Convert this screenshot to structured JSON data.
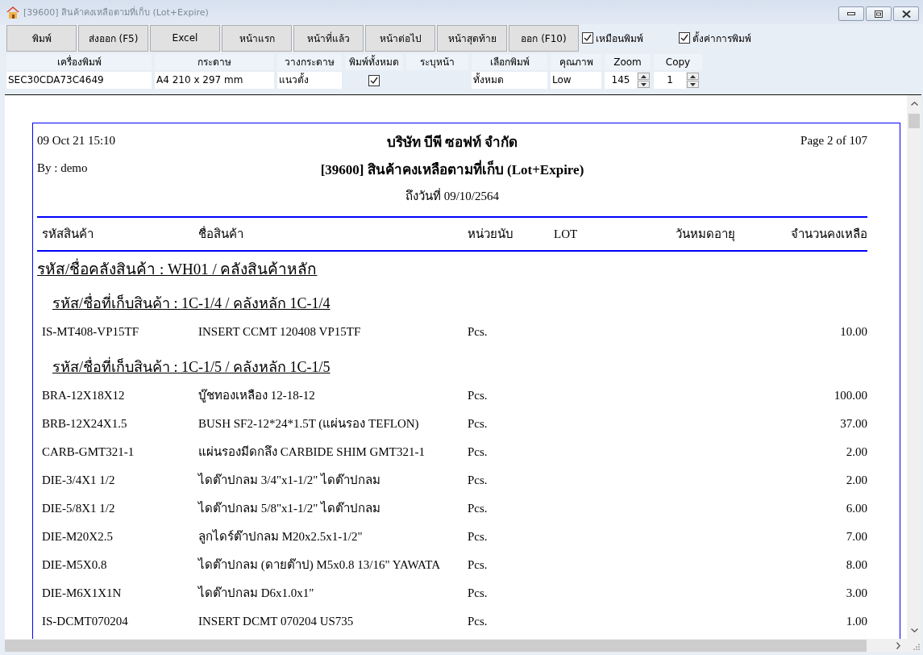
{
  "window": {
    "title": "[39600] สินค้าคงเหลือตามที่เก็บ (Lot+Expire)"
  },
  "toolbar": {
    "buttons": [
      "พิมพ์",
      "ส่งออก (F5)",
      "Excel",
      "หน้าแรก",
      "หน้าที่แล้ว",
      "หน้าต่อไป",
      "หน้าสุดท้าย",
      "ออก (F10)"
    ],
    "checkboxes": [
      {
        "label": "เหมือนพิมพ์",
        "checked": true
      },
      {
        "label": "ตั้งค่าการพิมพ์",
        "checked": true
      }
    ]
  },
  "print_settings": [
    {
      "kind": "text",
      "label": "เครื่องพิมพ์",
      "value": "SEC30CDA73C4649"
    },
    {
      "kind": "text",
      "label": "กระดาษ",
      "value": "A4 210 x 297 mm"
    },
    {
      "kind": "text",
      "label": "วางกระดาษ",
      "value": "แนวตั้ง"
    },
    {
      "kind": "checkbox",
      "label": "พิมพ์ทั้งหมด",
      "checked": true
    },
    {
      "kind": "label",
      "label": "ระบุหน้า"
    },
    {
      "kind": "text",
      "label": "เลือกพิมพ์",
      "value": "ทั้งหมด"
    },
    {
      "kind": "text",
      "label": "คุณภาพ",
      "value": "Low"
    },
    {
      "kind": "spinner",
      "label": "Zoom",
      "value": "145"
    },
    {
      "kind": "spinner",
      "label": "Copy",
      "value": "1"
    }
  ],
  "report": {
    "printed_at": "09 Oct 21 15:10",
    "company": "บริษัท บีพี ซอฟท์ จำกัด",
    "page": "Page 2 of 107",
    "printed_by": "By : demo",
    "title": "[39600] สินค้าคงเหลือตามที่เก็บ (Lot+Expire)",
    "as_of": "ถึงวันที่ 09/10/2564",
    "columns": [
      "รหัสสินค้า",
      "ชื่อสินค้า",
      "หน่วยนับ",
      "LOT",
      "วันหมดอายุ",
      "จำนวนคงเหลือ"
    ],
    "groups": [
      {
        "heading": "รหัส/ชื่อคลังสินค้า : WH01 / คลังสินค้าหลัก",
        "locations": [
          {
            "heading": "รหัส/ชื่อที่เก็บสินค้า : 1C-1/4 / คลังหลัก 1C-1/4",
            "rows": [
              {
                "code": "IS-MT408-VP15TF",
                "name": "INSERT CCMT 120408 VP15TF",
                "unit": "Pcs.",
                "quantity": "10.00"
              }
            ]
          },
          {
            "heading": "รหัส/ชื่อที่เก็บสินค้า : 1C-1/5 / คลังหลัก 1C-1/5",
            "rows": [
              {
                "code": "BRA-12X18X12",
                "name": "บู๊ชทองเหลือง 12-18-12",
                "unit": "Pcs.",
                "quantity": "100.00"
              },
              {
                "code": "BRB-12X24X1.5",
                "name": "BUSH SF2-12*24*1.5T (แผ่นรอง TEFLON)",
                "unit": "Pcs.",
                "quantity": "37.00"
              },
              {
                "code": "CARB-GMT321-1",
                "name": "แผ่นรองมีดกลึง CARBIDE SHIM GMT321-1",
                "unit": "Pcs.",
                "quantity": "2.00"
              },
              {
                "code": "DIE-3/4X1 1/2",
                "name": "ไดต๊าปกลม 3/4\"x1-1/2\" ไดต๊าปกลม",
                "unit": "Pcs.",
                "quantity": "2.00"
              },
              {
                "code": "DIE-5/8X1 1/2",
                "name": "ไดต๊าปกลม 5/8\"x1-1/2\" ไดต๊าปกลม",
                "unit": "Pcs.",
                "quantity": "6.00"
              },
              {
                "code": "DIE-M20X2.5",
                "name": "ลูกไดร์ต๊าปกลม M20x2.5x1-1/2\"",
                "unit": "Pcs.",
                "quantity": "7.00"
              },
              {
                "code": "DIE-M5X0.8",
                "name": "ไดต๊าปกลม (ดายต๊าป) M5x0.8 13/16\" YAWATA",
                "unit": "Pcs.",
                "quantity": "8.00"
              },
              {
                "code": "DIE-M6X1X1N",
                "name": "ไดต๊าปกลม D6x1.0x1\"",
                "unit": "Pcs.",
                "quantity": "3.00"
              },
              {
                "code": "IS-DCMT070204",
                "name": "INSERT DCMT 070204 US735",
                "unit": "Pcs.",
                "quantity": "1.00"
              }
            ]
          }
        ]
      }
    ]
  }
}
